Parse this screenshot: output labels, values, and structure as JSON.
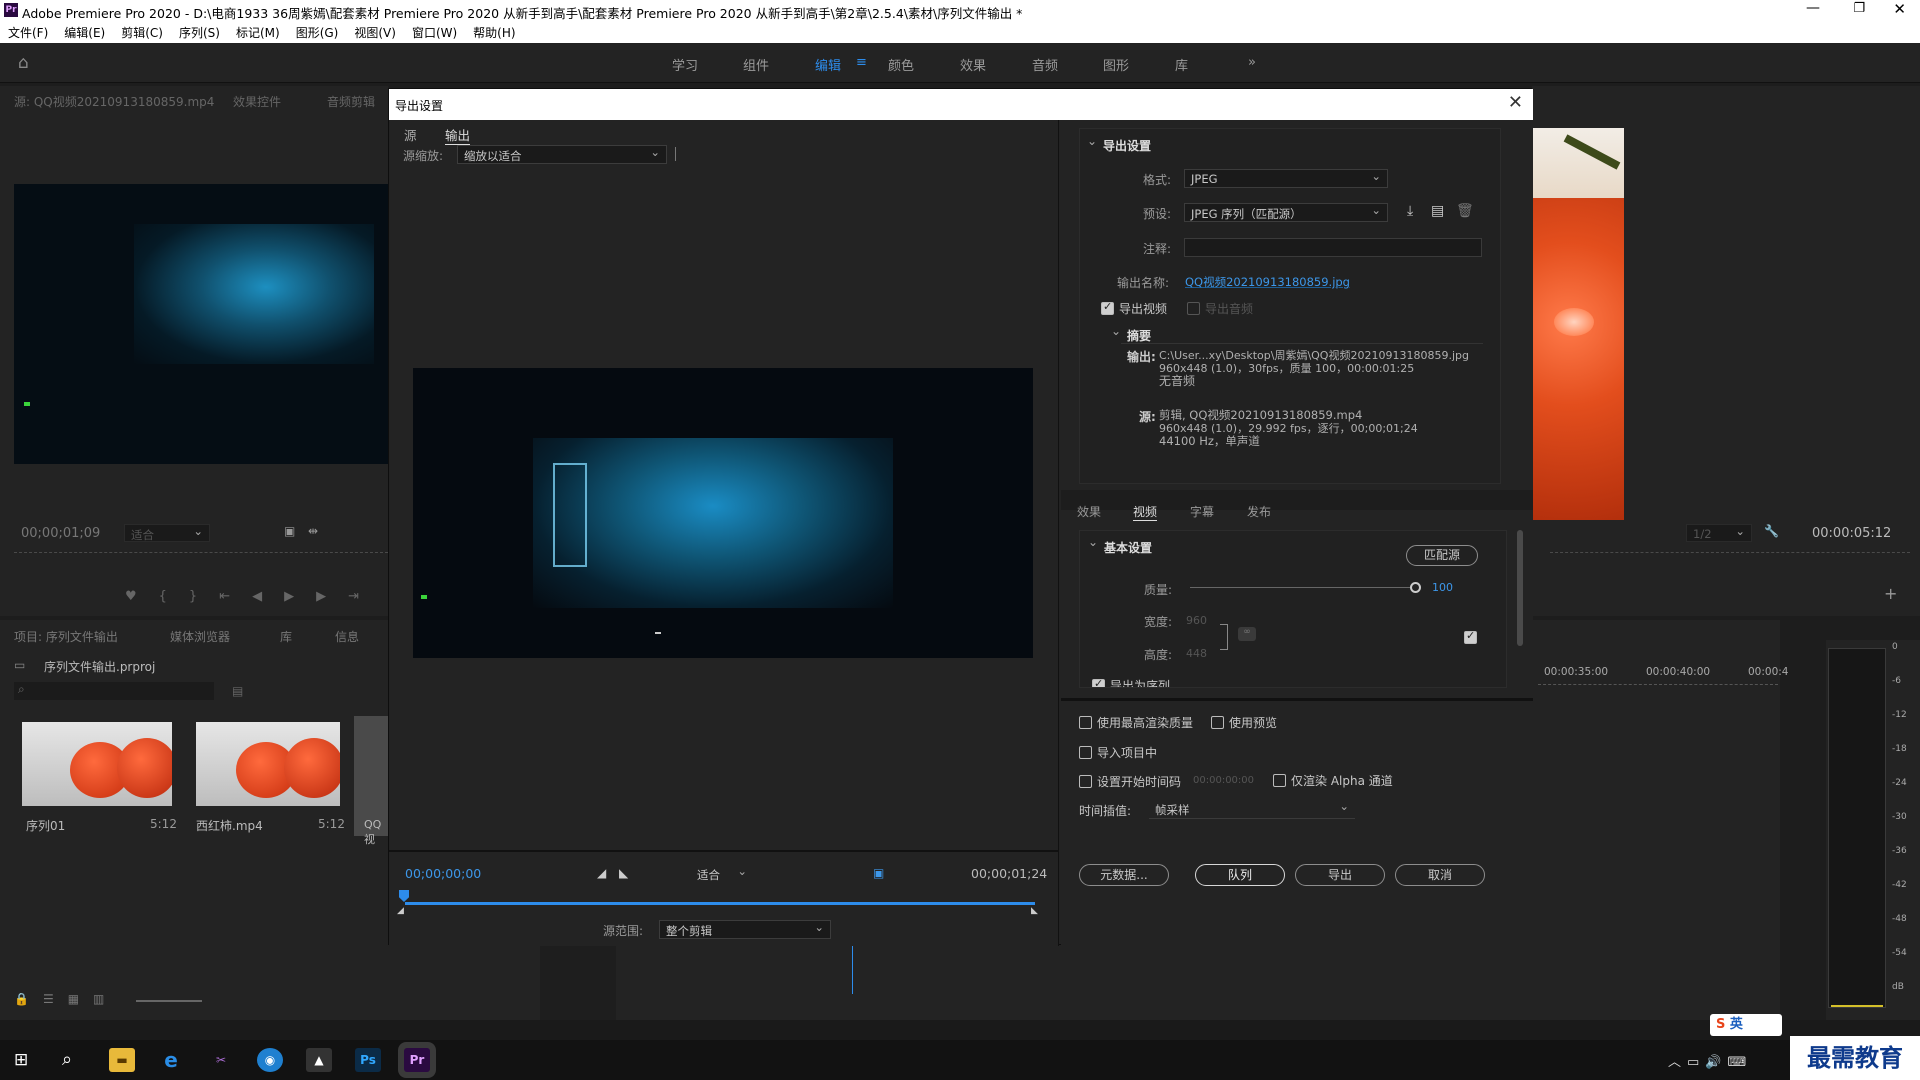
{
  "titlebar": {
    "title": "Adobe Premiere Pro 2020 - D:\\电商1933 36周紫嫣\\配套素材 Premiere Pro 2020 从新手到高手\\配套素材 Premiere Pro 2020 从新手到高手\\第2章\\2.5.4\\素材\\序列文件输出 *"
  },
  "menu": [
    "文件(F)",
    "编辑(E)",
    "剪辑(C)",
    "序列(S)",
    "标记(M)",
    "图形(G)",
    "视图(V)",
    "窗口(W)",
    "帮助(H)"
  ],
  "workspaces": [
    "学习",
    "组件",
    "编辑",
    "颜色",
    "效果",
    "音频",
    "图形",
    "库"
  ],
  "source_panel": {
    "tabs": [
      "源: QQ视频20210913180859.mp4",
      "效果控件",
      "音频剪辑"
    ],
    "timecode": "00;00;01;09",
    "fit": "适合"
  },
  "program_panel": {
    "timecode": "00:00:05:12",
    "fraction": "1/2"
  },
  "project_panel": {
    "tabs": [
      "项目: 序列文件输出",
      "媒体浏览器",
      "库",
      "信息"
    ],
    "file": "序列文件输出.prproj",
    "items": [
      {
        "name": "序列01",
        "dur": "5:12"
      },
      {
        "name": "西红柿.mp4",
        "dur": "5:12"
      },
      {
        "name": "QQ视"
      }
    ]
  },
  "timeline": {
    "ticks": [
      "00:00:35:00",
      "00:00:40:00",
      "00:00:4"
    ]
  },
  "meter": {
    "labels": [
      "0",
      "-6",
      "-12",
      "-18",
      "-24",
      "-30",
      "-36",
      "-42",
      "-48",
      "-54",
      "dB"
    ]
  },
  "dialog": {
    "title": "导出设置",
    "left_tabs": [
      "源",
      "输出"
    ],
    "scale_label": "源缩放:",
    "scale_value": "缩放以适合",
    "tc_start": "00;00;00;00",
    "fit": "适合",
    "tc_end": "00;00;01;24",
    "range_label": "源范围:",
    "range_value": "整个剪辑",
    "export_settings": {
      "header": "导出设置",
      "format_label": "格式:",
      "format": "JPEG",
      "preset_label": "预设:",
      "preset": "JPEG 序列（匹配源）",
      "comment_label": "注释:",
      "output_label": "输出名称:",
      "output_name": "QQ视频20210913180859.jpg",
      "export_video": "导出视频",
      "export_audio": "导出音频"
    },
    "summary": {
      "header": "摘要",
      "out_label": "输出:",
      "out_lines": [
        "C:\\User...xy\\Desktop\\周紫嫣\\QQ视频20210913180859.jpg",
        "960x448 (1.0)，30fps，质量 100，00:00:01:25",
        "无音频"
      ],
      "src_label": "源:",
      "src_lines": [
        "剪辑, QQ视频20210913180859.mp4",
        "960x448 (1.0)，29.992 fps，逐行，00;00;01;24",
        "44100 Hz，单声道"
      ]
    },
    "right_tabs": [
      "效果",
      "视频",
      "字幕",
      "发布"
    ],
    "basic": {
      "header": "基本设置",
      "match_btn": "匹配源",
      "quality_label": "质量:",
      "quality": "100",
      "quality_level": 100,
      "width_label": "宽度:",
      "width": "960",
      "height_label": "高度:",
      "height": "448",
      "export_seq": "导出为序列"
    },
    "opts": {
      "max_quality": "使用最高渲染质量",
      "use_preview": "使用预览",
      "import_project": "导入项目中",
      "set_tc": "设置开始时间码",
      "tc_value": "00:00:00:00",
      "alpha": "仅渲染 Alpha 通道",
      "interp_label": "时间插值:",
      "interp": "帧采样"
    },
    "buttons": {
      "metadata": "元数据...",
      "queue": "队列",
      "export": "导出",
      "cancel": "取消"
    }
  },
  "taskbar": {
    "ime": "英",
    "brand": "最需教育"
  }
}
